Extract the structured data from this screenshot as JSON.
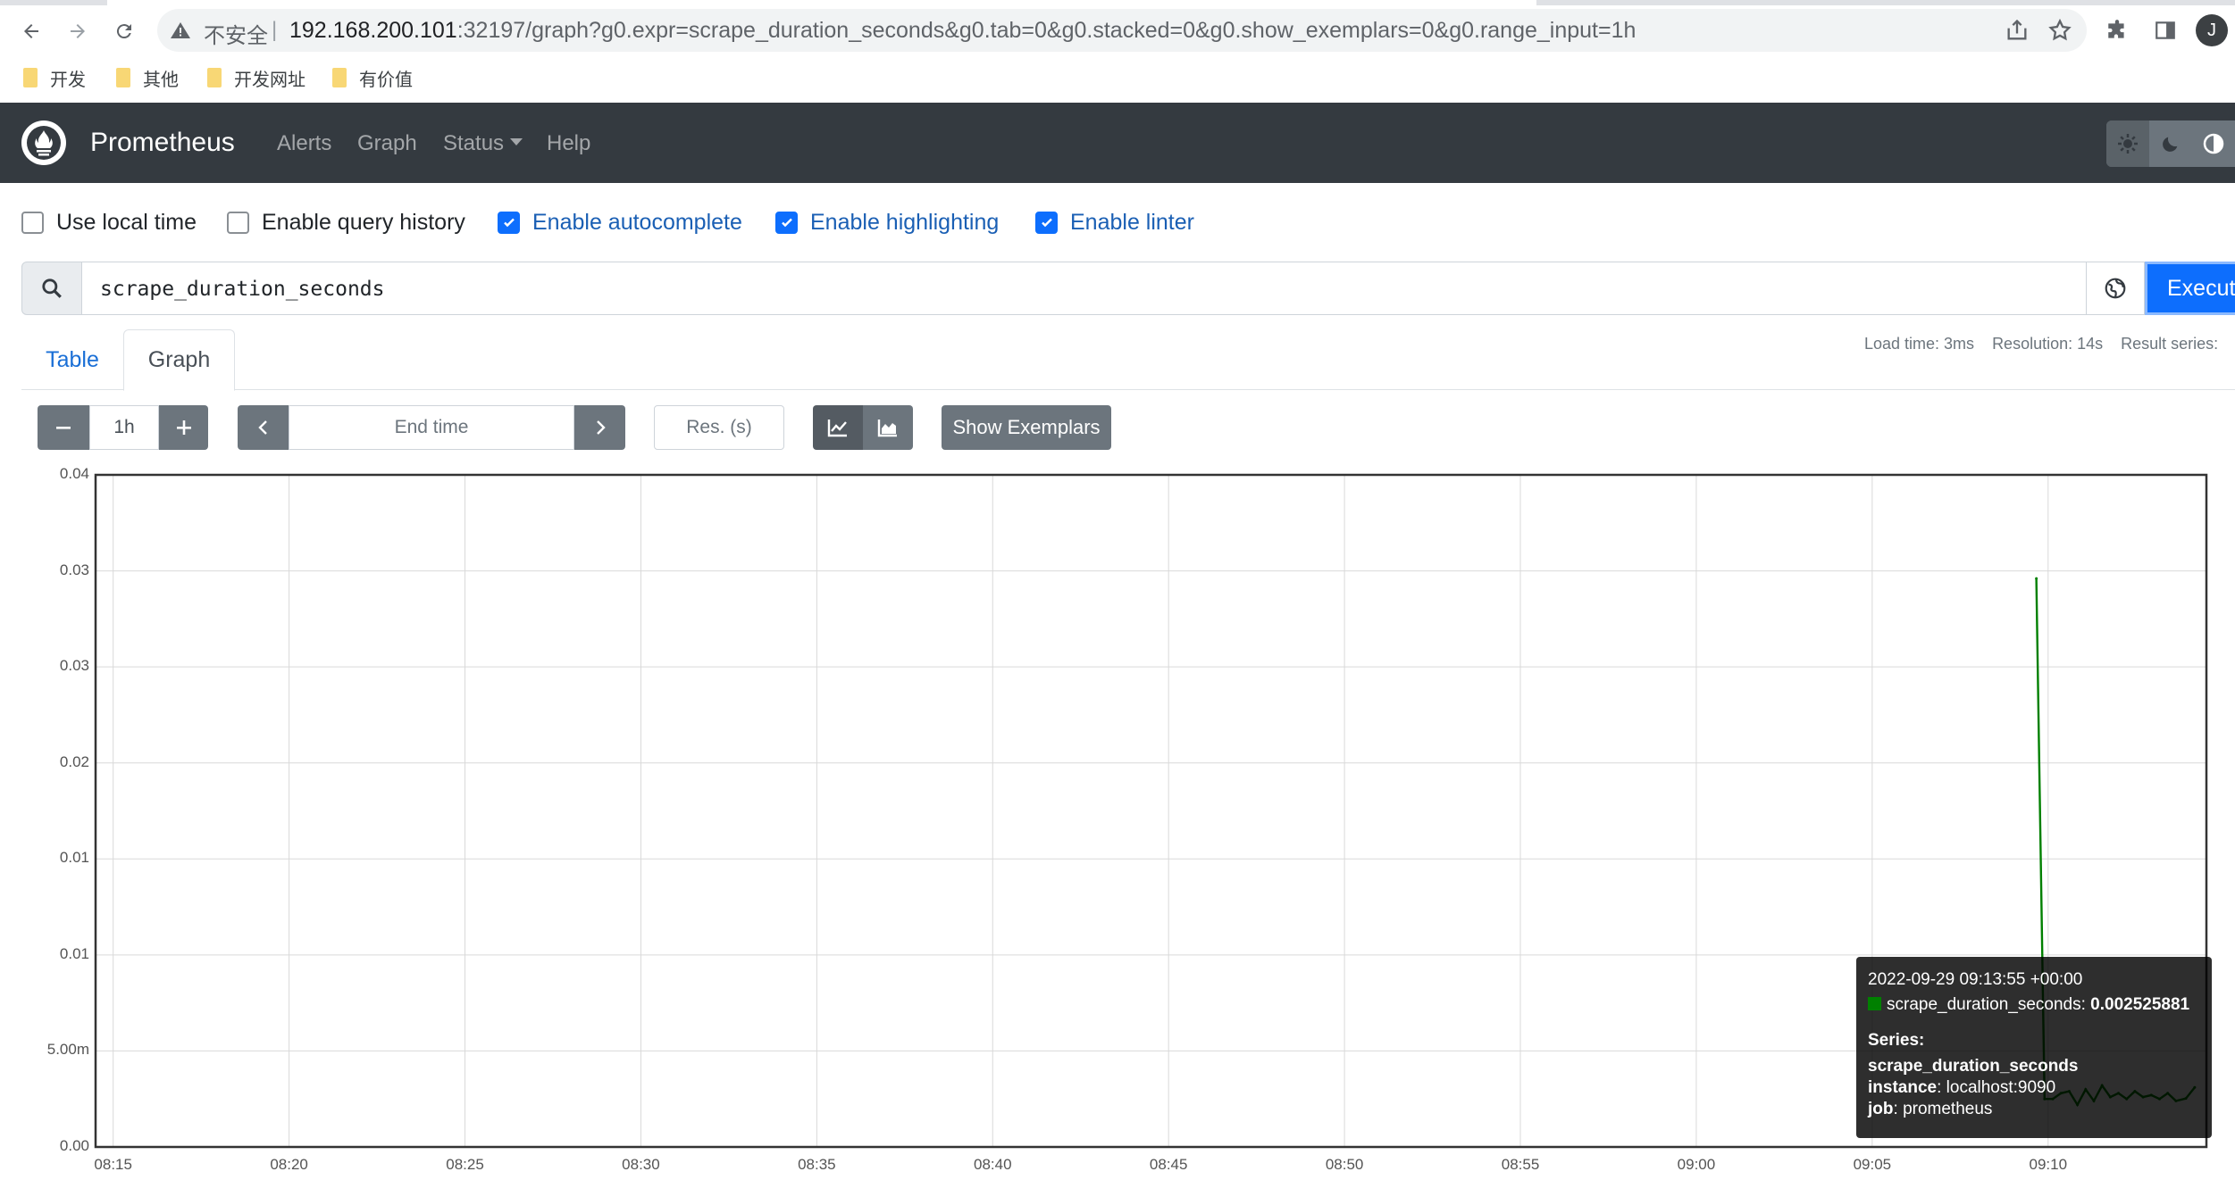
{
  "browser": {
    "insecure_label": "不安全",
    "separator": "|",
    "url_host": "192.168.200.101",
    "url_rest": ":32197/graph?g0.expr=scrape_duration_seconds&g0.tab=0&g0.stacked=0&g0.show_exemplars=0&g0.range_input=1h",
    "profile_initial": "J",
    "bookmarks": [
      "开发",
      "其他",
      "开发网址",
      "有价值"
    ]
  },
  "navbar": {
    "brand": "Prometheus",
    "links": {
      "alerts": "Alerts",
      "graph": "Graph",
      "status": "Status",
      "help": "Help"
    }
  },
  "options": {
    "use_local_time": {
      "label": "Use local time",
      "checked": false
    },
    "query_history": {
      "label": "Enable query history",
      "checked": false
    },
    "autocomplete": {
      "label": "Enable autocomplete",
      "checked": true
    },
    "highlighting": {
      "label": "Enable highlighting",
      "checked": true
    },
    "linter": {
      "label": "Enable linter",
      "checked": true
    }
  },
  "query": {
    "expression": "scrape_duration_seconds",
    "execute_label": "Execute"
  },
  "tabs": {
    "table": "Table",
    "graph": "Graph",
    "active": "graph"
  },
  "stats": {
    "load_time": "Load time: 3ms",
    "resolution": "Resolution: 14s",
    "result_series": "Result series:"
  },
  "controls": {
    "range_value": "1h",
    "end_time_placeholder": "End time",
    "resolution_placeholder": "Res. (s)",
    "show_exemplars_label": "Show Exemplars",
    "line_mode_active": true
  },
  "chart_data": {
    "type": "line",
    "title": "",
    "xlabel": "",
    "ylabel": "",
    "x_ticks": [
      "08:15",
      "08:20",
      "08:25",
      "08:30",
      "08:35",
      "08:40",
      "08:45",
      "08:50",
      "08:55",
      "09:00",
      "09:05",
      "09:10"
    ],
    "y_ticks": [
      "0.04",
      "0.03",
      "0.03",
      "0.02",
      "0.01",
      "0.01",
      "5.00m",
      "0.00"
    ],
    "ylim": [
      0,
      0.035
    ],
    "x_range": [
      "08:14:30",
      "09:14:30"
    ],
    "grid": true,
    "series": [
      {
        "name": "scrape_duration_seconds",
        "color": "#008000",
        "x": [
          "09:09:40",
          "09:09:54",
          "09:10:08",
          "09:10:22",
          "09:10:36",
          "09:10:50",
          "09:11:04",
          "09:11:18",
          "09:11:32",
          "09:11:46",
          "09:12:00",
          "09:12:14",
          "09:12:28",
          "09:12:42",
          "09:12:56",
          "09:13:10",
          "09:13:24",
          "09:13:38",
          "09:13:55",
          "09:14:10"
        ],
        "values": [
          0.0296,
          0.0025,
          0.0025,
          0.0028,
          0.0029,
          0.0022,
          0.003,
          0.0024,
          0.0032,
          0.0026,
          0.0028,
          0.0025,
          0.0029,
          0.0026,
          0.0027,
          0.0025,
          0.0028,
          0.0024,
          0.002525881,
          0.0031
        ]
      }
    ]
  },
  "tooltip": {
    "timestamp": "2022-09-29 09:13:55 +00:00",
    "metric": "scrape_duration_seconds",
    "value": "0.002525881",
    "series_heading": "Series:",
    "series_name": "scrape_duration_seconds",
    "labels": [
      {
        "key": "instance",
        "value": "localhost:9090"
      },
      {
        "key": "job",
        "value": "prometheus"
      }
    ]
  },
  "colors": {
    "navbar": "#343a40",
    "primary": "#0d6efd",
    "button": "#6c757d",
    "series": "#008000"
  }
}
